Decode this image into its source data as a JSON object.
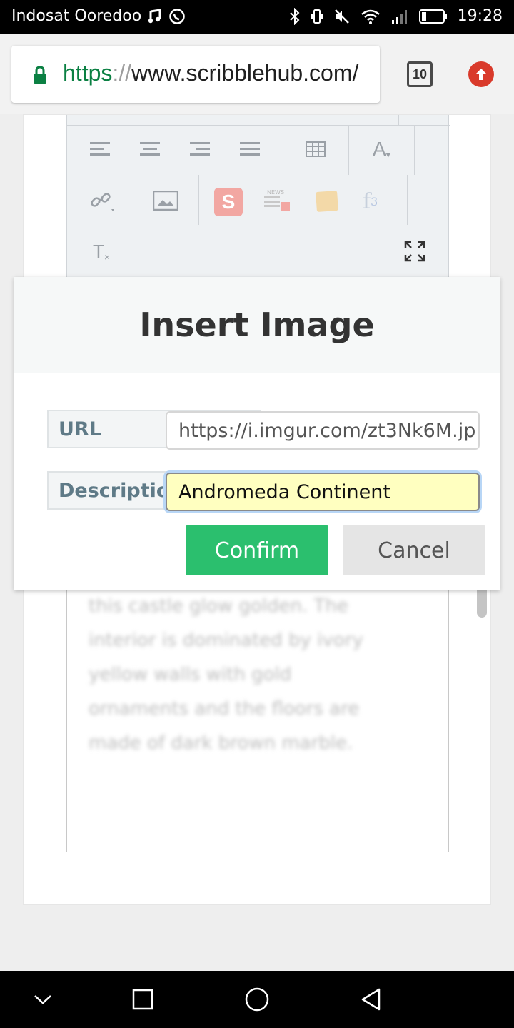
{
  "status_bar": {
    "carrier": "Indosat Ooredoo",
    "time": "19:28",
    "icons": [
      "music-icon",
      "whatsapp-icon",
      "bluetooth-icon",
      "vibrate-icon",
      "mute-icon",
      "wifi-icon",
      "signal-icon",
      "battery-icon"
    ]
  },
  "browser": {
    "url_scheme": "https",
    "url_sep": "://",
    "url_host": "www.scribblehub.com/",
    "tab_count": "10",
    "colors": {
      "secure": "#0b8043",
      "update_badge": "#d93a2b"
    }
  },
  "editor": {
    "toolbar_icons": [
      "align-left-icon",
      "align-center-icon",
      "align-right-icon",
      "align-justify-icon",
      "table-icon",
      "text-color-icon",
      "link-icon",
      "image-icon",
      "scribblehub-icon",
      "news-icon",
      "sticky-note-icon",
      "formula-icon",
      "clear-format-icon",
      "fullscreen-icon"
    ],
    "text_color_label": "A",
    "clear_format_label": "T",
    "formula_label": "f",
    "formula_sup": "3",
    "news_label": "NEWS",
    "sh_label": "S",
    "body_lines": [
      "this castle glow golden. The",
      "interior is dominated by ivory",
      "yellow walls with gold",
      "ornaments and the floors are",
      "made of dark brown marble."
    ]
  },
  "dialog": {
    "title": "Insert Image",
    "url_label": "URL",
    "url_value": "https://i.imgur.com/zt3Nk6M.jp",
    "description_label": "Description",
    "description_value": "Andromeda Continent",
    "confirm_label": "Confirm",
    "cancel_label": "Cancel",
    "colors": {
      "confirm": "#2bbf6e",
      "active_field": "#ffffc0"
    }
  },
  "nav_bar": {
    "icons": [
      "hide-keyboard-icon",
      "recents-icon",
      "home-icon",
      "back-icon"
    ]
  }
}
